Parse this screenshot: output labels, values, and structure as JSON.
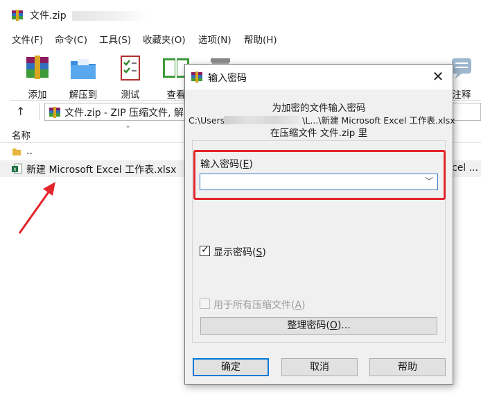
{
  "window": {
    "title": "文件.zip"
  },
  "menu": [
    "文件(F)",
    "命令(C)",
    "工具(S)",
    "收藏夹(O)",
    "选项(N)",
    "帮助(H)"
  ],
  "toolbar": {
    "buttons": [
      {
        "label": "添加",
        "icon": "add-archive-icon"
      },
      {
        "label": "解压到",
        "icon": "extract-folder-icon"
      },
      {
        "label": "测试",
        "icon": "test-checklist-icon"
      },
      {
        "label": "查看",
        "icon": "view-book-icon"
      }
    ],
    "right_label": "注释"
  },
  "address": {
    "text": "文件.zip - ZIP 压缩文件, 解"
  },
  "filelist": {
    "column_name": "名称",
    "rows": [
      {
        "name": "..",
        "icon": "folder-up-icon"
      },
      {
        "name": "新建 Microsoft Excel 工作表.xlsx",
        "icon": "excel-file-icon",
        "trailing": "cel ..."
      }
    ]
  },
  "dialog": {
    "title": "输入密码",
    "info_line1": "为加密的文件输入密码",
    "info_line2_prefix": "C:\\Users",
    "info_line2_suffix": "\\L...\\新建 Microsoft Excel 工作表.xlsx",
    "info_line3": "在压缩文件 文件.zip 里",
    "password_label": "输入密码(",
    "password_label_key": "E",
    "password_label_end": ")",
    "password_value": "",
    "show_password": {
      "label": "显示密码(",
      "key": "S",
      "end": ")",
      "checked": true
    },
    "use_for_all": {
      "label": "用于所有压缩文件(",
      "key": "A",
      "end": ")",
      "checked": false,
      "enabled": false
    },
    "organize_button": {
      "label": "整理密码(",
      "key": "O",
      "end": ")..."
    },
    "ok_label": "确定",
    "cancel_label": "取消",
    "help_label": "帮助"
  },
  "colors": {
    "highlight_red": "#e2242b",
    "focus_blue": "#0078d7"
  }
}
